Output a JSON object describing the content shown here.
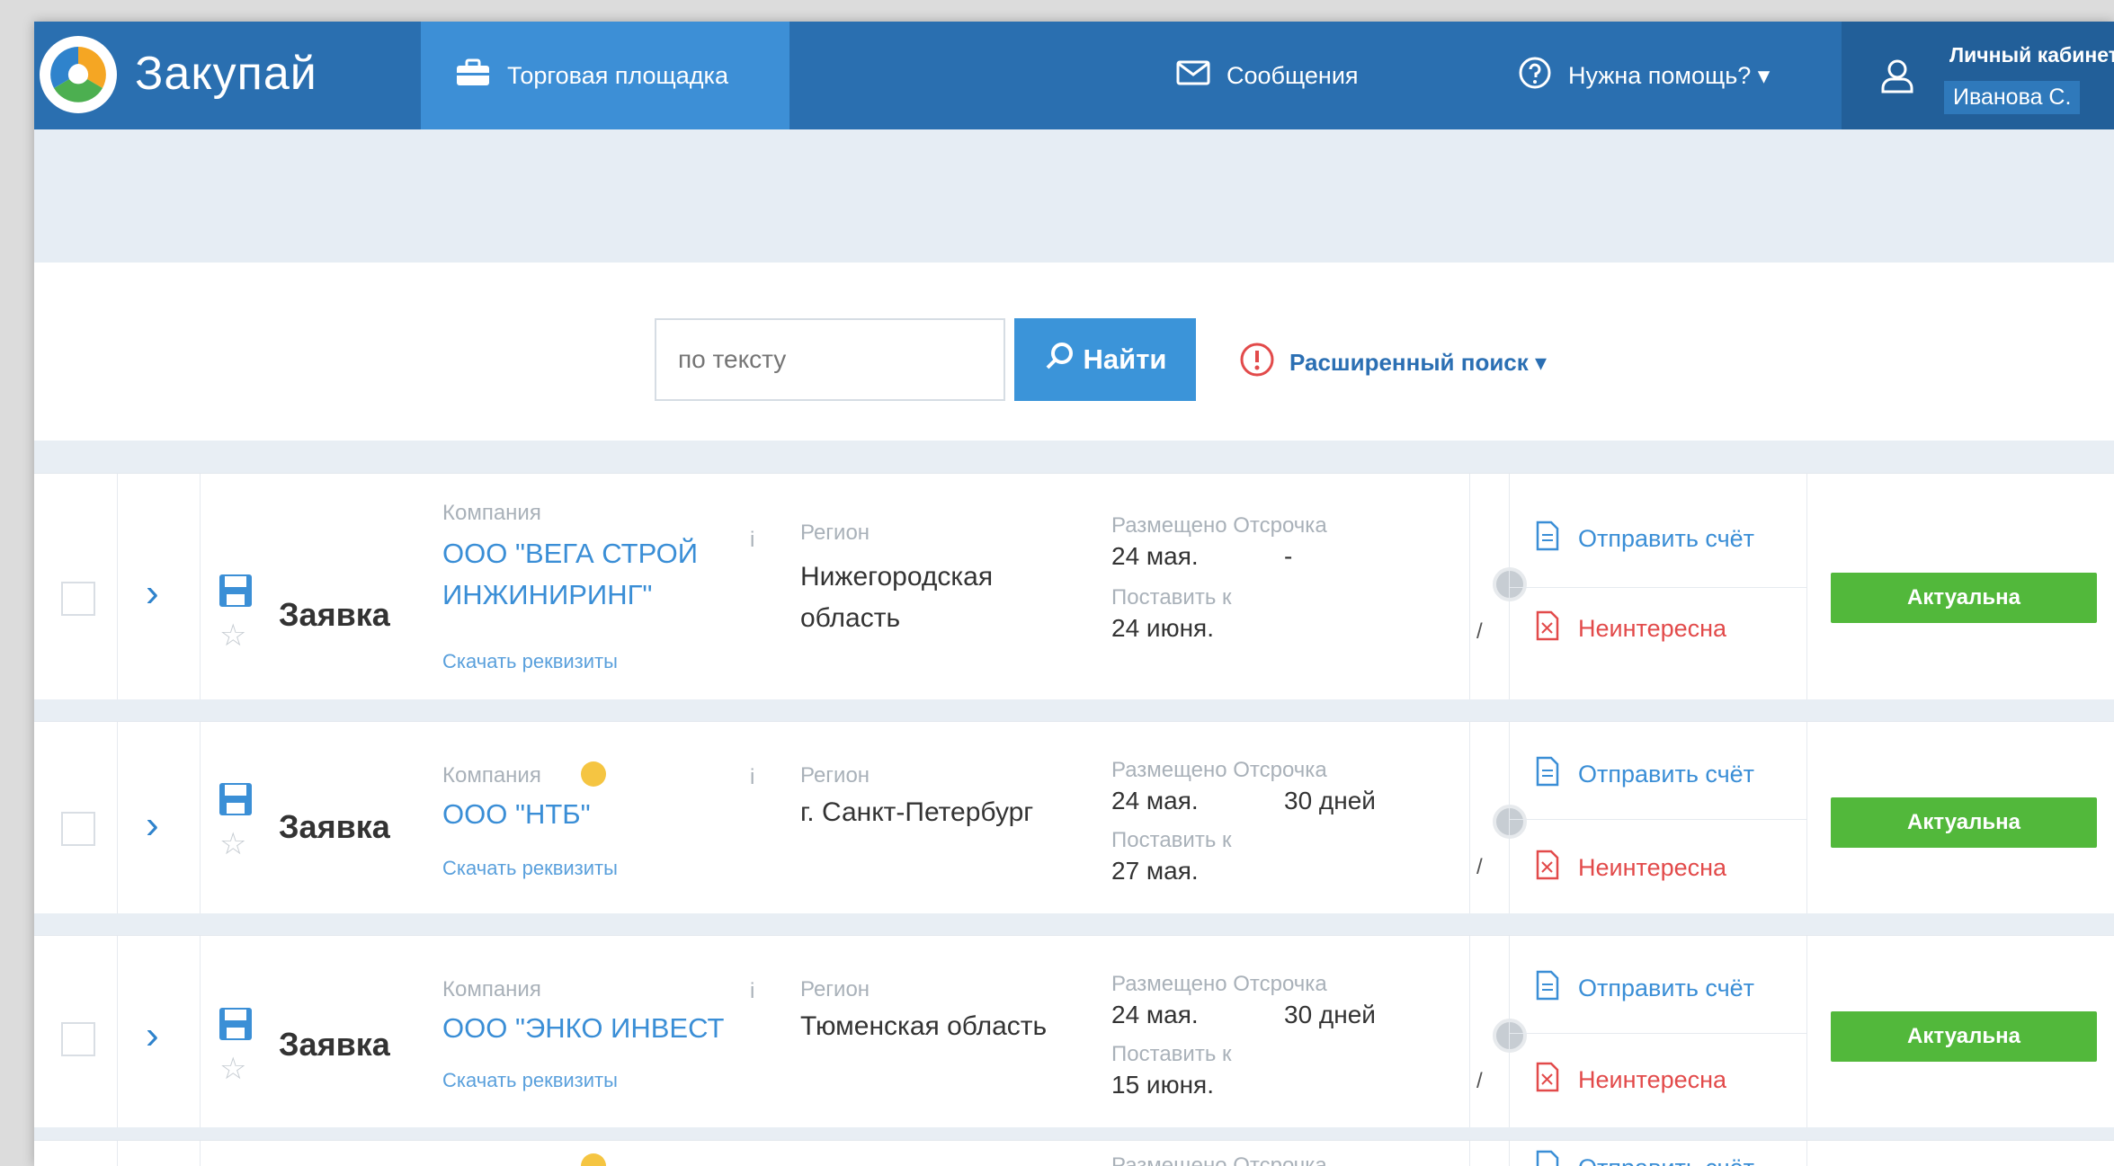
{
  "app": {
    "title": "Закупай",
    "colors": {
      "nav": "#2a6fb0",
      "nav_active": "#3d8fd6",
      "accent": "#3b94d9",
      "status_green": "#52b83b",
      "reject_red": "#e24a4a"
    }
  },
  "nav": {
    "marketplace": "Торговая площадка",
    "messages": "Сообщения",
    "help": "Нужна помощь? ▾",
    "account_title": "Личный кабинет",
    "account_user": "Иванова С."
  },
  "search": {
    "placeholder": "по тексту",
    "button": "Найти",
    "advanced": "Расширенный поиск ▾"
  },
  "rows": [
    {
      "kind": "Заявка",
      "company_label": "Компания",
      "company": "ООО \"ВЕГА СТРОЙ ИНЖИНИРИНГ\"",
      "download": "Скачать реквизиты",
      "region_label": "Регион",
      "region": "Нижегородская область",
      "placed_label": "Размещено  Отсрочка",
      "placed": "24 мая.",
      "delay": "-",
      "deliver_label": "Поставить к",
      "deliver": "24 июня.",
      "send": "Отправить счёт",
      "reject": "Неинтересна",
      "status": "Актуальна"
    },
    {
      "kind": "Заявка",
      "company_label": "Компания",
      "company": "ООО \"НТБ\"",
      "download": "Скачать реквизиты",
      "region_label": "Регион",
      "region": "г. Санкт-Петербург",
      "placed_label": "Размещено  Отсрочка",
      "placed": "24 мая.",
      "delay": "30 дней",
      "deliver_label": "Поставить к",
      "deliver": "27 мая.",
      "send": "Отправить счёт",
      "reject": "Неинтересна",
      "status": "Актуальна"
    },
    {
      "kind": "Заявка",
      "company_label": "Компания",
      "company": "ООО \"ЭНКО ИНВЕСТ",
      "download": "Скачать реквизиты",
      "region_label": "Регион",
      "region": "Тюменская область",
      "placed_label": "Размещено  Отсрочка",
      "placed": "24 мая.",
      "delay": "30 дней",
      "deliver_label": "Поставить к",
      "deliver": "15 июня.",
      "send": "Отправить счёт",
      "reject": "Неинтересна",
      "status": "Актуальна"
    }
  ],
  "partial_row": {
    "placed_label": "Размещено  Отсрочка",
    "send": "Отправить счёт"
  }
}
